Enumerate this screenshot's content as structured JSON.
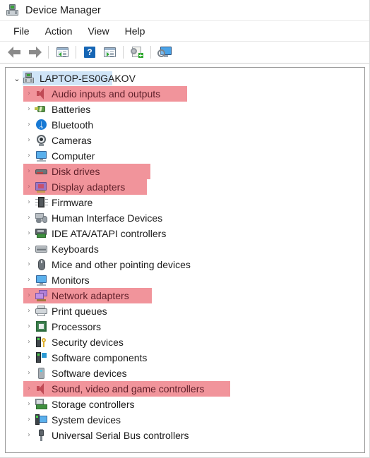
{
  "window": {
    "title": "Device Manager",
    "icon": "device-manager-icon"
  },
  "menubar": {
    "items": [
      {
        "label": "File"
      },
      {
        "label": "Action"
      },
      {
        "label": "View"
      },
      {
        "label": "Help"
      }
    ]
  },
  "toolbar": {
    "buttons": [
      {
        "name": "back-button",
        "icon": "back-arrow-icon"
      },
      {
        "name": "forward-button",
        "icon": "forward-arrow-icon"
      },
      {
        "name": "show-hide-console-tree-button",
        "icon": "console-tree-icon"
      },
      {
        "name": "help-button",
        "icon": "question-mark-icon"
      },
      {
        "name": "properties-button",
        "icon": "properties-pane-icon"
      },
      {
        "name": "update-driver-button",
        "icon": "scan-gear-icon"
      },
      {
        "name": "scan-hardware-changes-button",
        "icon": "monitor-search-icon"
      }
    ]
  },
  "tree": {
    "root": {
      "label": "LAPTOP-ES0GAKOV",
      "icon": "computer-icon",
      "expanded": true,
      "selected": true,
      "chevron": "⌄"
    },
    "chevron_collapsed": "›",
    "highlight_color": "#f1949b",
    "highlight_text_color": "#5e1f29",
    "selection_color": "#cfe4f7",
    "items": [
      {
        "label": "Audio inputs and outputs",
        "icon": "speaker-icon",
        "icon_class": "ic-speaker",
        "highlighted": true,
        "hl_width": 232
      },
      {
        "label": "Batteries",
        "icon": "battery-icon",
        "icon_class": "ic-battery",
        "highlighted": false
      },
      {
        "label": "Bluetooth",
        "icon": "bluetooth-icon",
        "icon_class": "ic-bt",
        "highlighted": false
      },
      {
        "label": "Cameras",
        "icon": "camera-icon",
        "icon_class": "ic-cam",
        "highlighted": false
      },
      {
        "label": "Computer",
        "icon": "monitor-icon",
        "icon_class": "ic-monitor",
        "highlighted": false
      },
      {
        "label": "Disk drives",
        "icon": "disk-drive-icon",
        "icon_class": "ic-disk",
        "highlighted": true,
        "hl_width": 180
      },
      {
        "label": "Display adapters",
        "icon": "display-adapter-icon",
        "icon_class": "ic-display",
        "highlighted": true,
        "hl_width": 175
      },
      {
        "label": "Firmware",
        "icon": "chip-icon",
        "icon_class": "ic-chip",
        "highlighted": false
      },
      {
        "label": "Human Interface Devices",
        "icon": "hid-icon",
        "icon_class": "ic-hid",
        "highlighted": false
      },
      {
        "label": "IDE ATA/ATAPI controllers",
        "icon": "ide-controller-icon",
        "icon_class": "ic-ide",
        "highlighted": false
      },
      {
        "label": "Keyboards",
        "icon": "keyboard-icon",
        "icon_class": "ic-kb",
        "highlighted": false
      },
      {
        "label": "Mice and other pointing devices",
        "icon": "mouse-icon",
        "icon_class": "ic-mouse",
        "highlighted": false
      },
      {
        "label": "Monitors",
        "icon": "monitor-icon",
        "icon_class": "ic-monitor",
        "highlighted": false
      },
      {
        "label": "Network adapters",
        "icon": "network-adapter-icon",
        "icon_class": "ic-net",
        "highlighted": true,
        "hl_width": 182
      },
      {
        "label": "Print queues",
        "icon": "printer-icon",
        "icon_class": "ic-print",
        "highlighted": false
      },
      {
        "label": "Processors",
        "icon": "processor-icon",
        "icon_class": "ic-cpu",
        "highlighted": false
      },
      {
        "label": "Security devices",
        "icon": "security-device-icon",
        "icon_class": "ic-sec",
        "highlighted": false
      },
      {
        "label": "Software components",
        "icon": "software-component-icon",
        "icon_class": "ic-swc",
        "highlighted": false
      },
      {
        "label": "Software devices",
        "icon": "software-device-icon",
        "icon_class": "ic-swd",
        "highlighted": false
      },
      {
        "label": "Sound, video and game controllers",
        "icon": "speaker-icon",
        "icon_class": "ic-speaker",
        "highlighted": true,
        "hl_width": 293
      },
      {
        "label": "Storage controllers",
        "icon": "storage-controller-icon",
        "icon_class": "ic-stor",
        "highlighted": false
      },
      {
        "label": "System devices",
        "icon": "system-device-icon",
        "icon_class": "ic-sys",
        "highlighted": false
      },
      {
        "label": "Universal Serial Bus controllers",
        "icon": "usb-icon",
        "icon_class": "ic-usb",
        "highlighted": false
      }
    ]
  }
}
